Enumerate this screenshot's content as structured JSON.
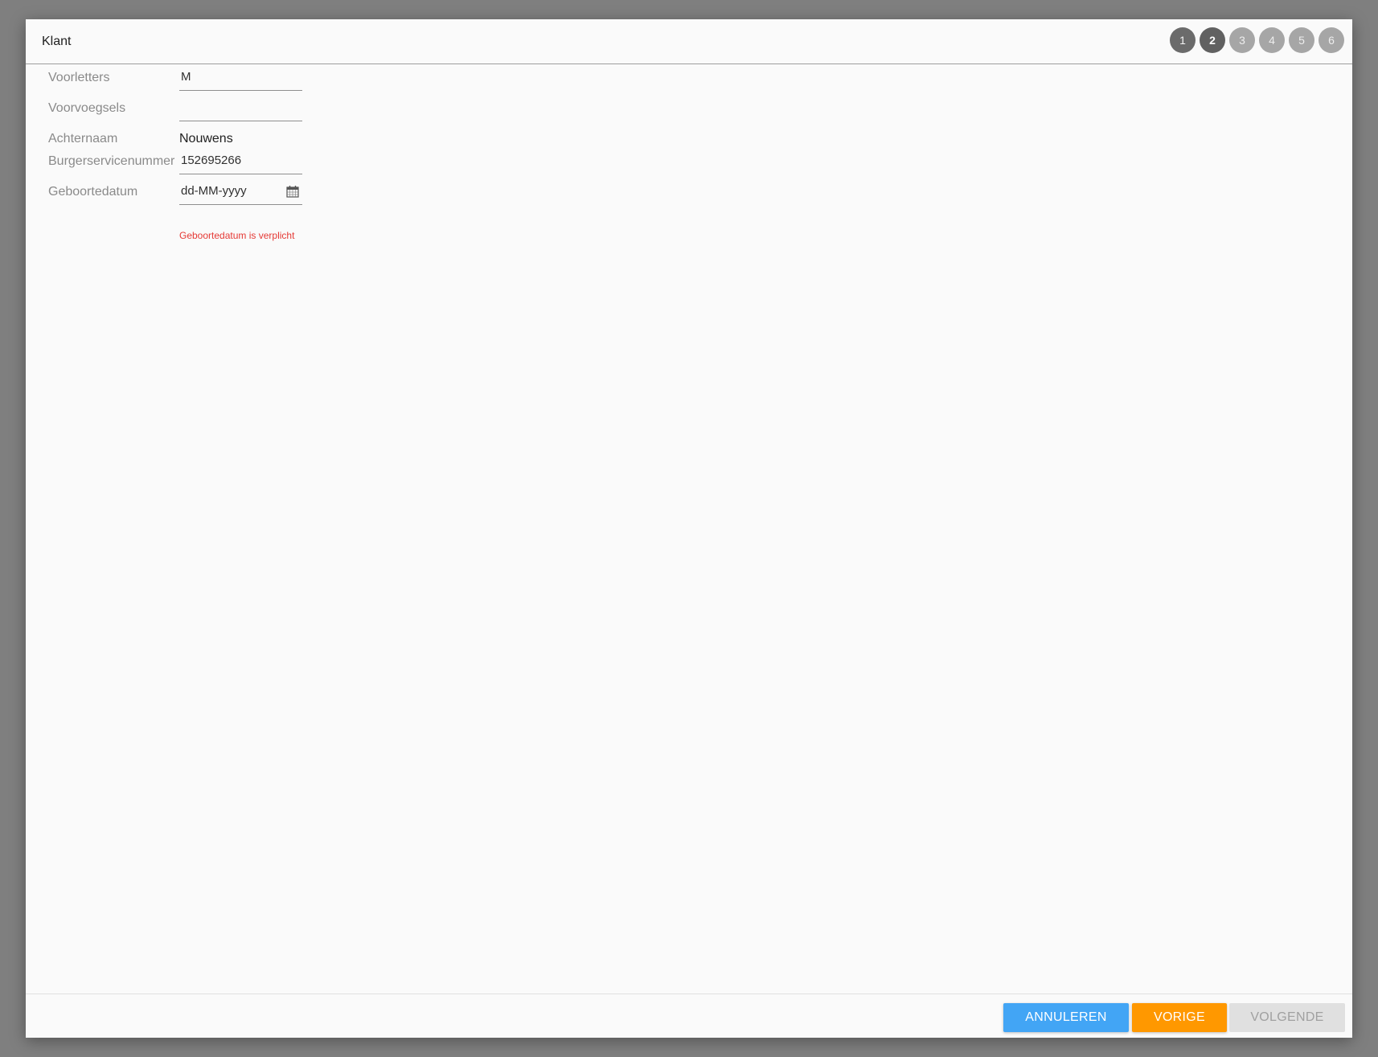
{
  "dialog": {
    "title": "Klant"
  },
  "steps": [
    {
      "label": "1",
      "state": "done"
    },
    {
      "label": "2",
      "state": "active"
    },
    {
      "label": "3",
      "state": "pending"
    },
    {
      "label": "4",
      "state": "pending"
    },
    {
      "label": "5",
      "state": "pending"
    },
    {
      "label": "6",
      "state": "pending"
    }
  ],
  "form": {
    "voorletters": {
      "label": "Voorletters",
      "value": "M"
    },
    "voorvoegsels": {
      "label": "Voorvoegsels",
      "value": ""
    },
    "achternaam": {
      "label": "Achternaam",
      "value": "Nouwens"
    },
    "bsn": {
      "label": "Burgerservicenummer",
      "value": "152695266"
    },
    "geboortedatum": {
      "label": "Geboortedatum",
      "value": "",
      "placeholder": "dd-MM-yyyy",
      "icon": "calendar-icon",
      "error": "Geboortedatum is verplicht"
    }
  },
  "footer": {
    "cancel_label": "ANNULEREN",
    "prev_label": "VORIGE",
    "next_label": "VOLGENDE"
  },
  "colors": {
    "cancel": "#42a5f5",
    "prev": "#ff9800",
    "next_disabled": "#e0e0e0",
    "error": "#e53935"
  }
}
